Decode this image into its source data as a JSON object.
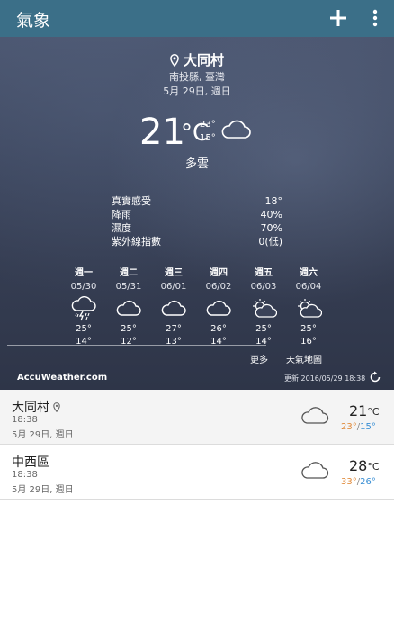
{
  "app": {
    "title": "氣象"
  },
  "current": {
    "location": "大同村",
    "region": "南投縣, 臺灣",
    "date": "5月 29日, 週日",
    "temp": "21",
    "unit": "°C",
    "high": "23°",
    "low": "15°",
    "condition": "多雲",
    "condition_icon": "cloud-icon"
  },
  "details": [
    {
      "label": "真實感受",
      "value": "18°"
    },
    {
      "label": "降雨",
      "value": "40%"
    },
    {
      "label": "濕度",
      "value": "70%"
    },
    {
      "label": "紫外線指數",
      "value": "0(低)"
    }
  ],
  "forecast": [
    {
      "day": "週一",
      "date": "05/30",
      "icon": "thunderstorm-icon",
      "high": "25°",
      "low": "14°"
    },
    {
      "day": "週二",
      "date": "05/31",
      "icon": "cloud-icon",
      "high": "25°",
      "low": "12°"
    },
    {
      "day": "週三",
      "date": "06/01",
      "icon": "cloud-icon",
      "high": "27°",
      "low": "13°"
    },
    {
      "day": "週四",
      "date": "06/02",
      "icon": "cloud-icon",
      "high": "26°",
      "low": "14°"
    },
    {
      "day": "週五",
      "date": "06/03",
      "icon": "partly-cloudy-icon",
      "high": "25°",
      "low": "14°"
    },
    {
      "day": "週六",
      "date": "06/04",
      "icon": "partly-cloudy-icon",
      "high": "25°",
      "low": "16°"
    }
  ],
  "links": {
    "more": "更多",
    "map": "天氣地圖"
  },
  "footer": {
    "brand": "AccuWeather.com",
    "updated": "更新 2016/05/29 18:38"
  },
  "cities": [
    {
      "name": "大同村",
      "time": "18:38",
      "date": "5月 29日, 週日",
      "temp": "21",
      "unit": "°C",
      "high": "23°",
      "low": "15°",
      "icon": "cloud-icon",
      "current": true
    },
    {
      "name": "中西區",
      "time": "18:38",
      "date": "5月 29日, 週日",
      "temp": "28",
      "unit": "°C",
      "high": "33°",
      "low": "26°",
      "icon": "cloud-icon",
      "current": false
    }
  ],
  "colors": {
    "appbar": "#3b6f88",
    "high": "#e08a3a",
    "low": "#3a8fd4"
  }
}
